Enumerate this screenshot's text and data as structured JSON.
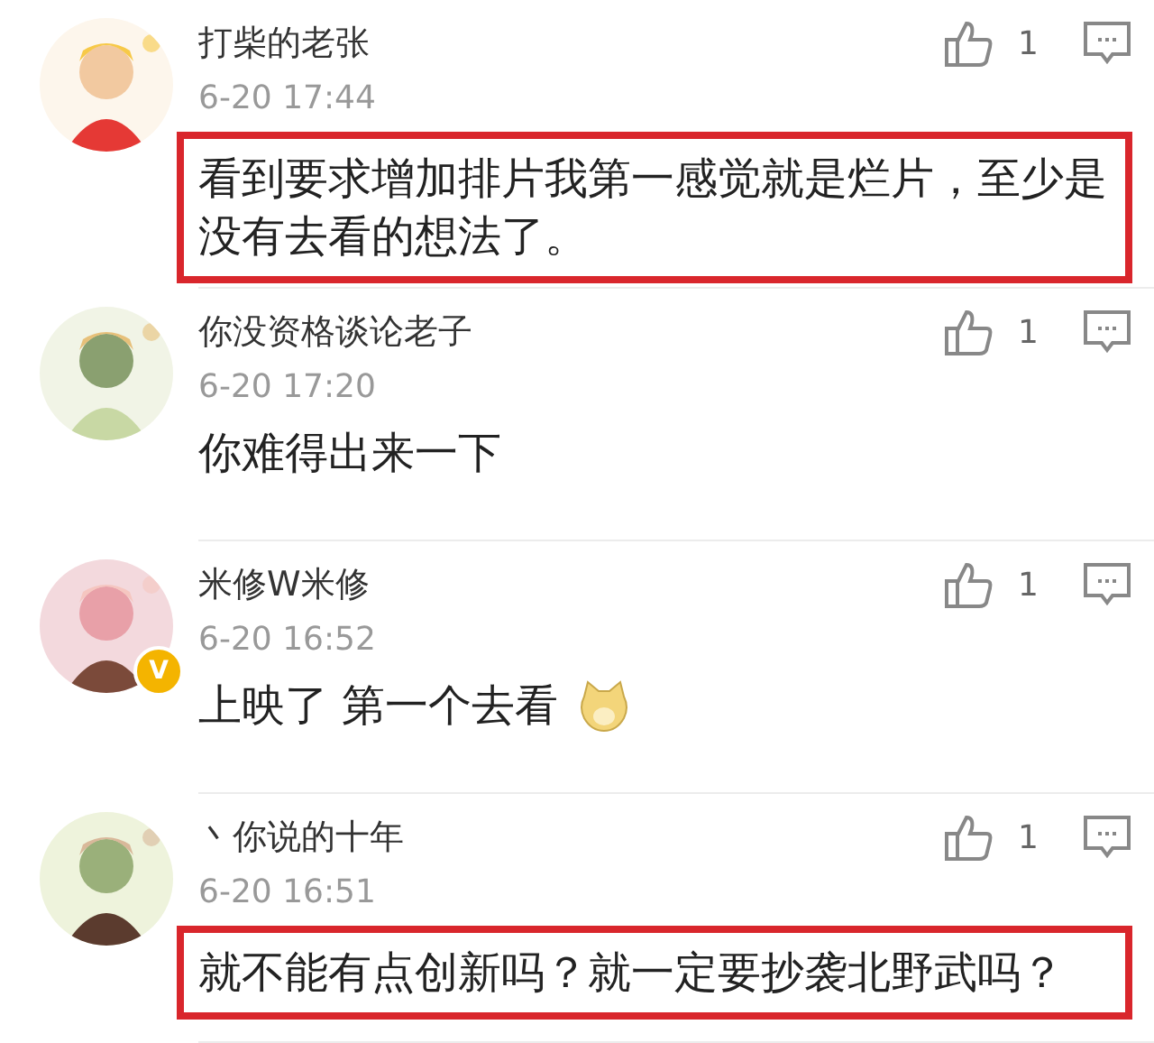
{
  "comments": [
    {
      "name": "打柴的老张",
      "likes": "1",
      "time": "6-20 17:44",
      "text": "看到要求增加排片我第一感觉就是烂片，至少是没有去看的想法了。",
      "highlighted": true,
      "sticker": false
    },
    {
      "name": "你没资格谈论老子",
      "likes": "1",
      "time": "6-20 17:20",
      "text": "你难得出来一下",
      "highlighted": false,
      "sticker": false
    },
    {
      "name": "米修W米修",
      "likes": "1",
      "time": "6-20 16:52",
      "text": "上映了 第一个去看",
      "highlighted": false,
      "badge": "V",
      "sticker": true
    },
    {
      "name": "丶你说的十年",
      "likes": "1",
      "time": "6-20 16:51",
      "text": "就不能有点创新吗？就一定要抄袭北野武吗？",
      "highlighted": true,
      "sticker": false
    }
  ]
}
